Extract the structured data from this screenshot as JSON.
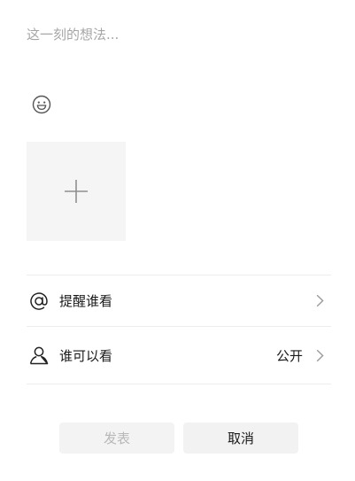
{
  "composer": {
    "placeholder": "这一刻的想法...",
    "text": ""
  },
  "icons": {
    "emoji": "smiley-face-icon",
    "add_photo": "plus-icon",
    "mention": "at-sign-icon",
    "visibility": "person-icon",
    "chevron": "chevron-right-icon"
  },
  "options": {
    "mention_label": "提醒谁看",
    "visibility_label": "谁可以看",
    "visibility_value": "公开"
  },
  "actions": {
    "publish_label": "发表",
    "cancel_label": "取消"
  },
  "colors": {
    "placeholder": "#a6a6a6",
    "publish_disabled_text": "#b8b8b8",
    "button_bg": "#f2f2f2",
    "photo_tile_bg": "#f5f5f5"
  }
}
